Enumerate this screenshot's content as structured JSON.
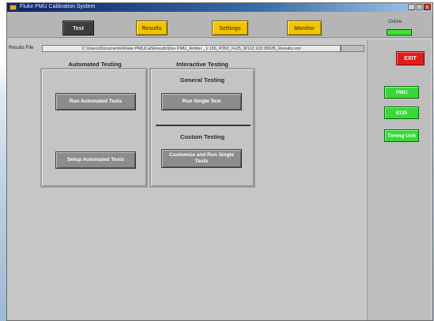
{
  "window": {
    "title": "Fluke PMU Calibration System",
    "controls": {
      "minimize": "_",
      "maximize": "□",
      "close": "x"
    }
  },
  "tabs": [
    {
      "label": "Test",
      "active": true
    },
    {
      "label": "Results",
      "active": false
    },
    {
      "label": "Settings",
      "active": false
    },
    {
      "label": "Monitor",
      "active": false
    }
  ],
  "status": {
    "online_label": "Online",
    "online_color": "#3ce33c"
  },
  "results_file": {
    "label": "Results File",
    "value": "C:\\Users\\Documents\\Fluke PMUCal\\Results\\Dev PMU_Arbiter _1:156_P050_Fs25_M1J2:103:35635_Results.xml"
  },
  "automated": {
    "heading": "Automated Testing",
    "run_button": "Run Automated Tests",
    "setup_button": "Setup Automated Tests"
  },
  "interactive": {
    "heading": "Interactive Testing",
    "general_heading": "General Testing",
    "run_single_button": "Run Single Test",
    "custom_heading": "Custom Testing",
    "customize_button": "Customize and Run Single Tests"
  },
  "side": {
    "exit_button": "EXIT",
    "pmu_button": "PMU",
    "device_button": "6135",
    "timing_button": "Timing Unit"
  },
  "colors": {
    "tab": "#f2c400",
    "tab_active": "#3c3c3c",
    "exit": "#e21b1b",
    "side_buttons": "#36d936"
  }
}
